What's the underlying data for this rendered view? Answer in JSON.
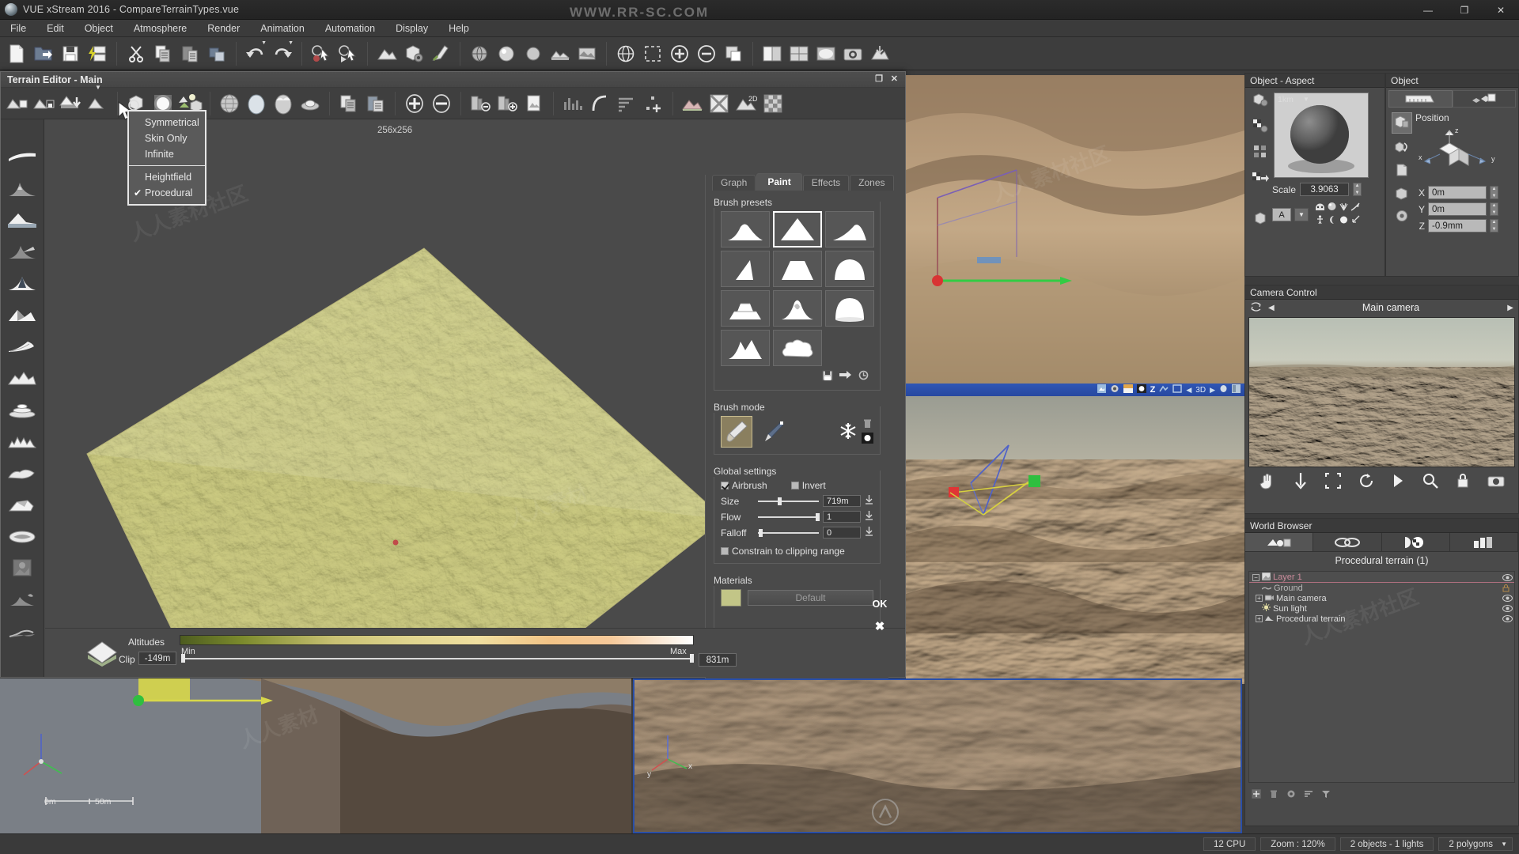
{
  "window": {
    "title": "VUE xStream 2016 - CompareTerrainTypes.vue",
    "minimize": "—",
    "maximize": "❐",
    "close": "✕",
    "watermark_top": "WWW.RR-SC.COM"
  },
  "menu": {
    "items": [
      "File",
      "Edit",
      "Object",
      "Atmosphere",
      "Render",
      "Animation",
      "Automation",
      "Display",
      "Help"
    ]
  },
  "toolbar": {
    "groups": [
      [
        "new-file-icon",
        "open-file-icon",
        "save-file-icon",
        "quick-render-icon"
      ],
      [
        "cut-icon",
        "copy-icon",
        "paste-icon",
        "duplicate-icon"
      ],
      [
        "undo-icon",
        "redo-icon"
      ],
      [
        "select-mode-icon",
        "play-select-icon"
      ],
      [
        "terrain-icon",
        "object-properties-icon",
        "material-editor-icon"
      ],
      [
        "function-editor-icon",
        "ecosystem-icon",
        "light-icon",
        "camera-icon",
        "atmosphere-icon"
      ],
      [
        "globe-icon",
        "zoom-in-icon",
        "zoom-out-icon",
        "fit-view-icon"
      ],
      [
        "layout-icon",
        "grid-icon",
        "render-icon",
        "snapshot-icon",
        "export-icon"
      ]
    ]
  },
  "terrain_editor": {
    "title": "Terrain Editor - Main",
    "resolution": "256x256",
    "window_buttons": {
      "restore": "❐",
      "close": "✕"
    },
    "toolbar_icons": [
      "load-terrain-icon",
      "save-terrain-icon",
      "export-terrain-icon",
      "terrain-type-icon",
      "primitive-icon",
      "light-preview-icon",
      "ecosystem-icon",
      "spherical-icon",
      "ellipsoid-icon",
      "egg-icon",
      "lens-icon",
      "copy-icon",
      "paste-icon",
      "add-icon",
      "subtract-icon",
      "resolution-down-icon",
      "resolution-up-icon",
      "new-layer-icon",
      "histogram-icon",
      "curve-icon",
      "sort-icon",
      "add-point-icon",
      "smooth-icon",
      "full-screen-icon",
      "2d-view-icon",
      "fx-icon"
    ],
    "left_rail_icons": [
      "flat-terrain-icon",
      "mountain-icon",
      "plateau-icon",
      "hill-icon",
      "peak-icon",
      "ridge-icon",
      "dune-icon",
      "rocky-icon",
      "terraced-icon",
      "craggy-icon",
      "eroded-icon",
      "cliff-icon",
      "canyon-icon",
      "heightmap-icon",
      "volcano-icon",
      "river-icon"
    ],
    "type_dropdown": {
      "items": [
        {
          "label": "Symmetrical",
          "underline": "S",
          "checked": false
        },
        {
          "label": "Skin Only",
          "underline": "k",
          "checked": false
        },
        {
          "label": "Infinite",
          "underline": "I",
          "checked": false
        },
        {
          "separator": true
        },
        {
          "label": "Heightfield",
          "underline": "H",
          "checked": false
        },
        {
          "label": "Procedural",
          "underline": "P",
          "checked": true
        }
      ],
      "check_glyph": "✔"
    },
    "tabs": [
      {
        "label": "Graph",
        "active": false
      },
      {
        "label": "Paint",
        "active": true
      },
      {
        "label": "Effects",
        "active": false
      },
      {
        "label": "Zones",
        "active": false
      }
    ],
    "brush_presets": {
      "label": "Brush presets",
      "items": [
        {
          "name": "bumpy-brush",
          "selected": false
        },
        {
          "name": "pointed-peak-brush",
          "selected": true
        },
        {
          "name": "slope-brush",
          "selected": false
        },
        {
          "name": "cone-brush",
          "selected": false
        },
        {
          "name": "plateau-brush",
          "selected": false
        },
        {
          "name": "dome-brush",
          "selected": false
        },
        {
          "name": "terraced-brush",
          "selected": false
        },
        {
          "name": "spiky-brush",
          "selected": false
        },
        {
          "name": "rounded-dome-brush",
          "selected": false
        },
        {
          "name": "ridge-brush",
          "selected": false
        },
        {
          "name": "cloud-brush",
          "selected": false
        }
      ],
      "action_icons": [
        "save-preset-icon",
        "apply-preset-icon",
        "reset-preset-icon"
      ]
    },
    "brush_mode": {
      "label": "Brush mode",
      "modes": [
        {
          "name": "paint-brush-icon",
          "selected": true
        },
        {
          "name": "fine-brush-icon",
          "selected": false
        }
      ],
      "extra_icons": [
        "freeze-icon",
        "delete-icon",
        "dot-icon"
      ]
    },
    "global_settings": {
      "label": "Global settings",
      "airbrush": {
        "label": "Airbrush",
        "checked": true
      },
      "invert": {
        "label": "Invert",
        "checked": false
      },
      "size": {
        "label": "Size",
        "value": "719m",
        "fraction": 0.33
      },
      "flow": {
        "label": "Flow",
        "value": "1",
        "fraction": 0.95
      },
      "falloff": {
        "label": "Falloff",
        "value": "0",
        "fraction": 0.02
      },
      "constrain": {
        "label": "Constrain to clipping range",
        "checked": false
      }
    },
    "materials": {
      "label": "Materials",
      "swatch_color": "#c2c587",
      "current": "Default",
      "action_icons": [
        "save-material-icon",
        "edit-material-icon",
        "delete-material-icon"
      ]
    },
    "altitudes": {
      "label": "Altitudes",
      "clip_label": "Clip",
      "clip_value": "-149m",
      "min_label": "Min",
      "max_label": "Max",
      "max_value": "831m"
    },
    "ok_label": "OK",
    "cancel_label": "✖"
  },
  "object_aspect": {
    "title": "Object - Aspect",
    "preview_size": "1km",
    "scale": {
      "label": "Scale",
      "value": "3.9063"
    },
    "mapping_mode": "A",
    "side_icons": [
      "object-material-icon",
      "checker-material-icon",
      "multi-material-icon",
      "material-export-icon",
      "bounding-box-icon"
    ],
    "aspect_icons": [
      "face-icon",
      "sphere-icon",
      "grass-icon",
      "branch-icon",
      "person-icon",
      "moon-icon",
      "ball-icon",
      "pointer-icon"
    ]
  },
  "object_panel": {
    "title": "Object",
    "tabs": [
      "measure-tab",
      "transform-tab"
    ],
    "side_icons": [
      "position-icon",
      "rotate-icon",
      "book-icon",
      "scale-icon",
      "gear-icon"
    ],
    "position": {
      "label": "Position",
      "axis_labels": {
        "x": "X",
        "y": "Y",
        "z": "Z"
      },
      "x": "0m",
      "y": "0m",
      "z": "-0.9mm"
    }
  },
  "camera_control": {
    "title": "Camera Control",
    "camera_name": "Main camera",
    "prev_arrow": "◀",
    "next_arrow": "▶",
    "tool_icons": [
      "hand-icon",
      "move-down-icon",
      "select-region-icon",
      "orbit-icon",
      "play-icon",
      "zoom-icon",
      "lock-icon",
      "camera-icon"
    ]
  },
  "world_browser": {
    "title": "World Browser",
    "tabs": [
      "objects-tab",
      "links-tab",
      "materials-tab",
      "layers-tab"
    ],
    "header": "Procedural terrain (1)",
    "rows": [
      {
        "label": "Layer 1",
        "indent": 0,
        "type": "layer",
        "expander": "−",
        "icon": "layer-icon",
        "eye": "eye-icon"
      },
      {
        "label": "Ground",
        "indent": 1,
        "type": "item",
        "expander": "",
        "icon": "ground-icon",
        "eye": "lock-icon"
      },
      {
        "label": "Main camera",
        "indent": 1,
        "type": "item",
        "expander": "+",
        "icon": "camera-icon",
        "eye": "eye-icon"
      },
      {
        "label": "Sun light",
        "indent": 1,
        "type": "item",
        "expander": "",
        "icon": "sun-icon",
        "eye": "eye-icon"
      },
      {
        "label": "Procedural terrain",
        "indent": 1,
        "type": "item",
        "expander": "+",
        "icon": "terrain-icon",
        "eye": "eye-icon"
      }
    ],
    "footer_icons": [
      "add-icon",
      "delete-icon",
      "settings-icon",
      "sort-icon",
      "filter-icon"
    ]
  },
  "viewports": {
    "top_left": {
      "name": "top-view",
      "active": false
    },
    "main": {
      "name": "main-camera-view",
      "active": true,
      "toolbar_icons": [
        "display-mode-icon",
        "camera-icon",
        "gradient-icon",
        "ball-icon",
        "z-axis-icon",
        "wire-icon",
        "render-icon",
        "left-arrow-icon",
        "3d-label",
        "right-arrow-icon",
        "light-icon",
        "layout-icon"
      ],
      "z_label": "Z",
      "display_value": "3D"
    },
    "bottom_left": {
      "name": "front-view",
      "active": false,
      "scale_0": "0m",
      "scale_50": "50m"
    },
    "bottom_right": {
      "name": "side-view",
      "active": false
    }
  },
  "status_bar": {
    "cpu": "12 CPU",
    "zoom": "Zoom : 120%",
    "objects": "2 objects - 1 lights",
    "polygons": "2 polygons",
    "dropdown_arrow": "▼"
  },
  "watermarks": [
    "人人素材社区",
    "人人素材",
    "人人素材社区"
  ]
}
